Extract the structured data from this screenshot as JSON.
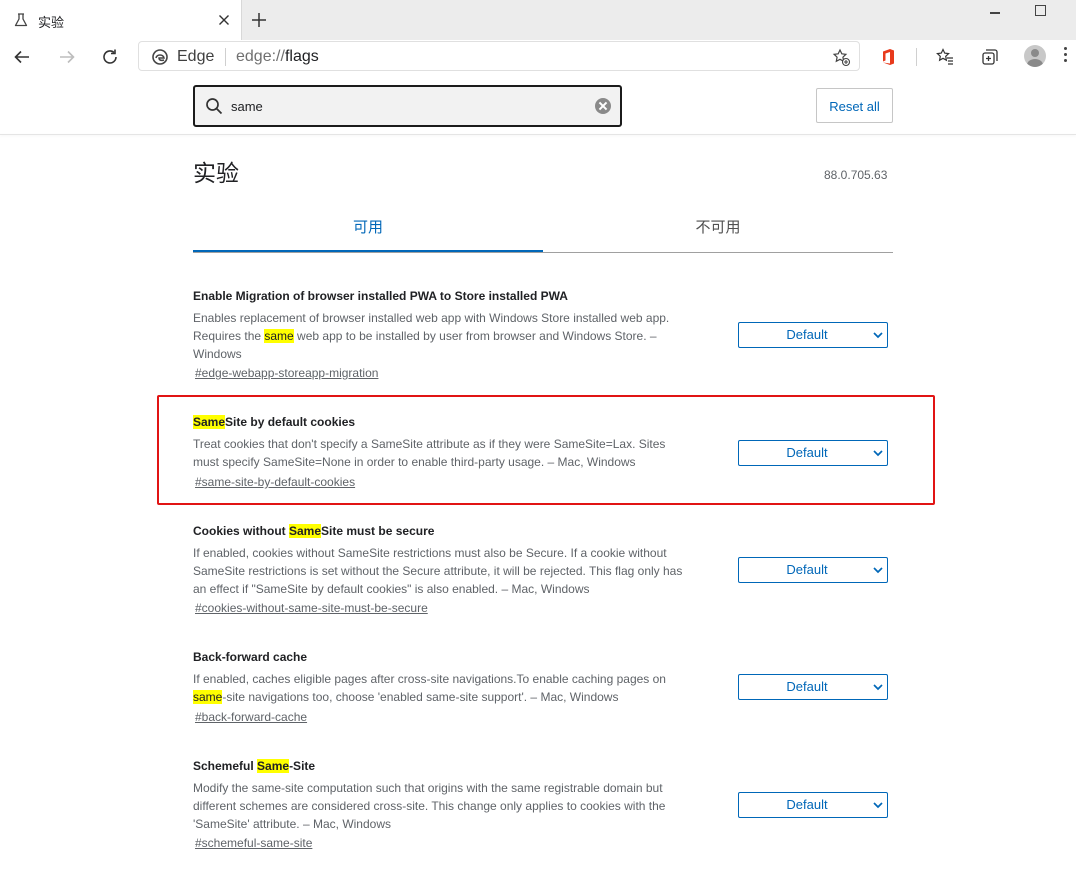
{
  "browser": {
    "tab_title": "实验",
    "omnibox_brand": "Edge",
    "url_scheme": "edge://",
    "url_path": "flags"
  },
  "search": {
    "value": "same"
  },
  "header": {
    "reset_label": "Reset all"
  },
  "page": {
    "title": "实验",
    "version": "88.0.705.63",
    "tabs": [
      {
        "label": "可用",
        "active": true
      },
      {
        "label": "不可用",
        "active": false
      }
    ]
  },
  "flags": [
    {
      "name": "Enable Migration of browser installed PWA to Store installed PWA",
      "desc_lines": [
        "Enables replacement of browser installed web app with Windows Store installed web app.",
        "Requires the same web app to be installed by user from browser and Windows Store. –",
        "Windows"
      ],
      "link": "#edge-webapp-storeapp-migration",
      "select": "Default"
    },
    {
      "name": "SameSite by default cookies",
      "desc_lines": [
        "Treat cookies that don't specify a SameSite attribute as if they were SameSite=Lax. Sites",
        "must specify SameSite=None in order to enable third-party usage. – Mac, Windows"
      ],
      "link": "#same-site-by-default-cookies",
      "select": "Default"
    },
    {
      "name": "Cookies without SameSite must be secure",
      "desc_lines": [
        "If enabled, cookies without SameSite restrictions must also be Secure. If a cookie without",
        "SameSite restrictions is set without the Secure attribute, it will be rejected. This flag only has",
        "an effect if \"SameSite by default cookies\" is also enabled. – Mac, Windows"
      ],
      "link": "#cookies-without-same-site-must-be-secure",
      "select": "Default"
    },
    {
      "name": "Back-forward cache",
      "desc_lines": [
        "If enabled, caches eligible pages after cross-site navigations.To enable caching pages on",
        "same-site navigations too, choose 'enabled same-site support'. – Mac, Windows"
      ],
      "link": "#back-forward-cache",
      "select": "Default"
    },
    {
      "name": "Schemeful Same-Site",
      "desc_lines": [
        "Modify the same-site computation such that origins with the same registrable domain but",
        "different schemes are considered cross-site. This change only applies to cookies with the",
        "'SameSite' attribute. – Mac, Windows"
      ],
      "link": "#schemeful-same-site",
      "select": "Default"
    }
  ],
  "colors": {
    "accent": "#0067b8",
    "highlight": "#ffff00",
    "annotation_box": "#e11414"
  }
}
